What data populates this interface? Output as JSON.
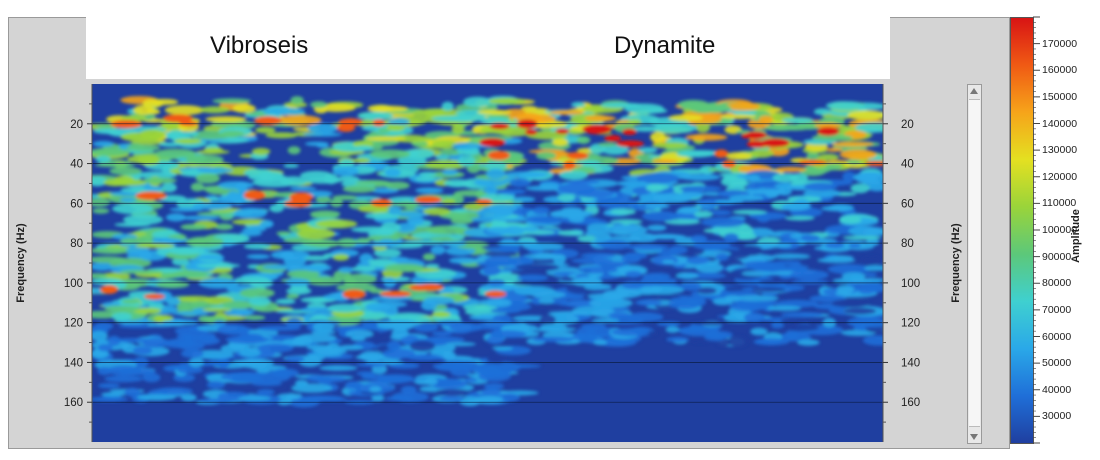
{
  "panels": {
    "left_title": "Vibroseis",
    "right_title": "Dynamite"
  },
  "chart_data": {
    "type": "heatmap",
    "title": "",
    "ylabel": "Frequency (Hz)",
    "y_ticks": [
      20,
      40,
      60,
      80,
      100,
      120,
      140,
      160
    ],
    "ylim": [
      0,
      180
    ],
    "colorbar": {
      "label": "Amplitude",
      "ticks": [
        30000,
        40000,
        50000,
        60000,
        70000,
        80000,
        90000,
        100000,
        110000,
        120000,
        130000,
        140000,
        150000,
        160000,
        170000
      ],
      "tick_labels": [
        "30000",
        "40000",
        "50000",
        "60000",
        "70000",
        "80000",
        "90000",
        "100000",
        "110000",
        "120000",
        "130000",
        "140000",
        "150000",
        "160000",
        "170000"
      ],
      "range": [
        20000,
        180000
      ],
      "colors": [
        "#1f3fa0",
        "#1f6fd8",
        "#2aa8e8",
        "#3fd0d0",
        "#5cc87a",
        "#9ad43a",
        "#e4e021",
        "#f6a41a",
        "#f05a14",
        "#d81414"
      ]
    },
    "background_amplitude": 25000,
    "bands": [
      {
        "panel": "Vibroseis",
        "freq_min": 8,
        "freq_max": 30,
        "amplitude": 110000
      },
      {
        "panel": "Vibroseis",
        "freq_min": 30,
        "freq_max": 60,
        "amplitude": 90000
      },
      {
        "panel": "Vibroseis",
        "freq_min": 60,
        "freq_max": 120,
        "amplitude": 85000
      },
      {
        "panel": "Vibroseis",
        "freq_min": 120,
        "freq_max": 160,
        "amplitude": 50000
      },
      {
        "panel": "Dynamite",
        "freq_min": 10,
        "freq_max": 45,
        "amplitude": 120000
      },
      {
        "panel": "Dynamite",
        "freq_min": 45,
        "freq_max": 80,
        "amplitude": 60000
      },
      {
        "panel": "Dynamite",
        "freq_min": 80,
        "freq_max": 130,
        "amplitude": 45000
      }
    ],
    "hotspots": [
      {
        "panel": "Vibroseis",
        "freq": 20,
        "amplitude": 170000
      },
      {
        "panel": "Vibroseis",
        "freq": 58,
        "amplitude": 160000
      },
      {
        "panel": "Vibroseis",
        "freq": 105,
        "amplitude": 170000
      },
      {
        "panel": "Dynamite",
        "freq": 22,
        "amplitude": 175000
      },
      {
        "panel": "Dynamite",
        "freq": 28,
        "amplitude": 175000
      },
      {
        "panel": "Dynamite",
        "freq": 38,
        "amplitude": 170000
      }
    ]
  }
}
